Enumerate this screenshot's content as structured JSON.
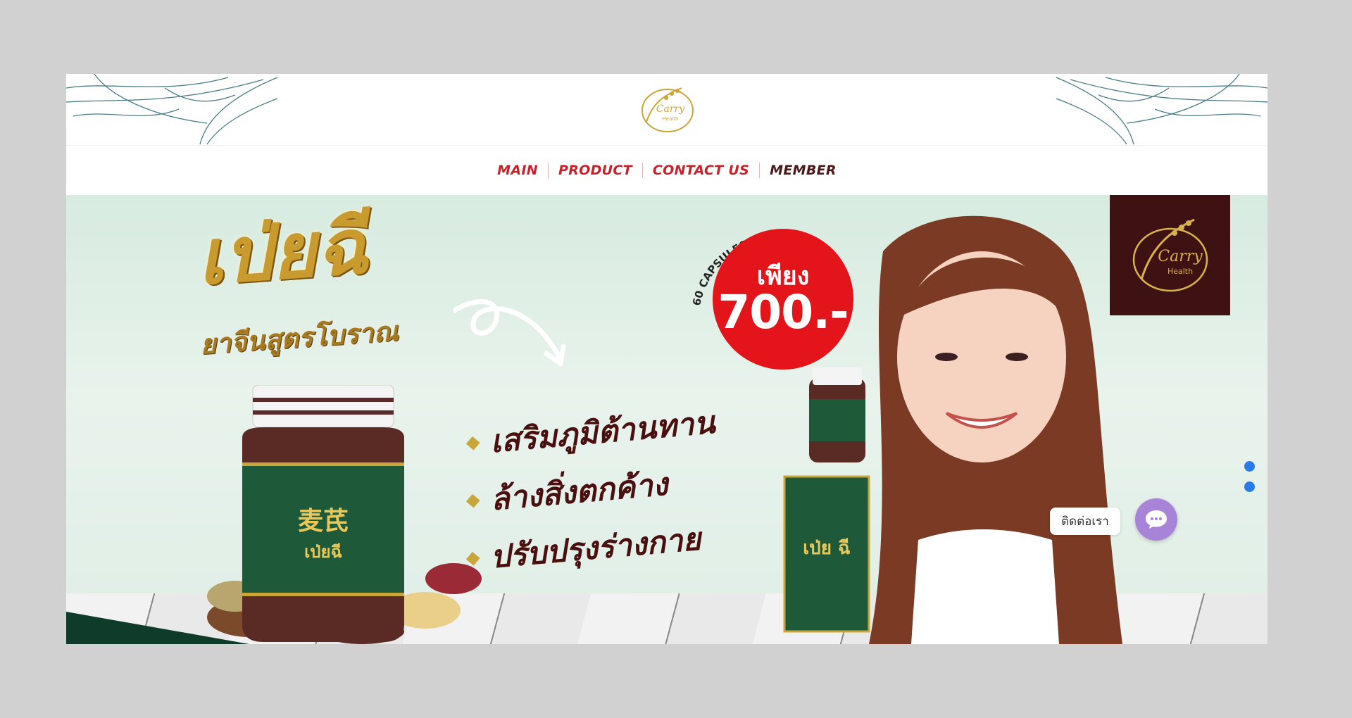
{
  "brand": {
    "name": "Carry",
    "sub": "Health"
  },
  "nav": {
    "items": [
      {
        "label": "MAIN"
      },
      {
        "label": "PRODUCT"
      },
      {
        "label": "CONTACT US"
      },
      {
        "label": "MEMBER"
      }
    ]
  },
  "banner": {
    "headline": "เป่ยฉี",
    "subheadline": "ยาจีนสูตรโบราณ",
    "jar_chinese": "麦芪",
    "jar_thai": "เป่ยฉี",
    "benefits": [
      "เสริมภูมิต้านทาน",
      "ล้างสิ่งตกค้าง",
      "ปรับปรุงร่างกาย"
    ],
    "price_prefix": "เพียง",
    "price_value": "700.-",
    "capsules": "60 CAPSULES",
    "box_label": "เป่ย ฉี"
  },
  "slider": {
    "dot_count": 2
  },
  "chat": {
    "label": "ติดต่อเรา"
  },
  "colors": {
    "nav_red": "#c8222a",
    "nav_dark": "#4a1818",
    "price_red": "#e3141a",
    "logo_bg": "#3e1212",
    "gold": "#c99a2e",
    "chat_purple": "#a884d9",
    "dot_blue": "#2a7bea"
  }
}
